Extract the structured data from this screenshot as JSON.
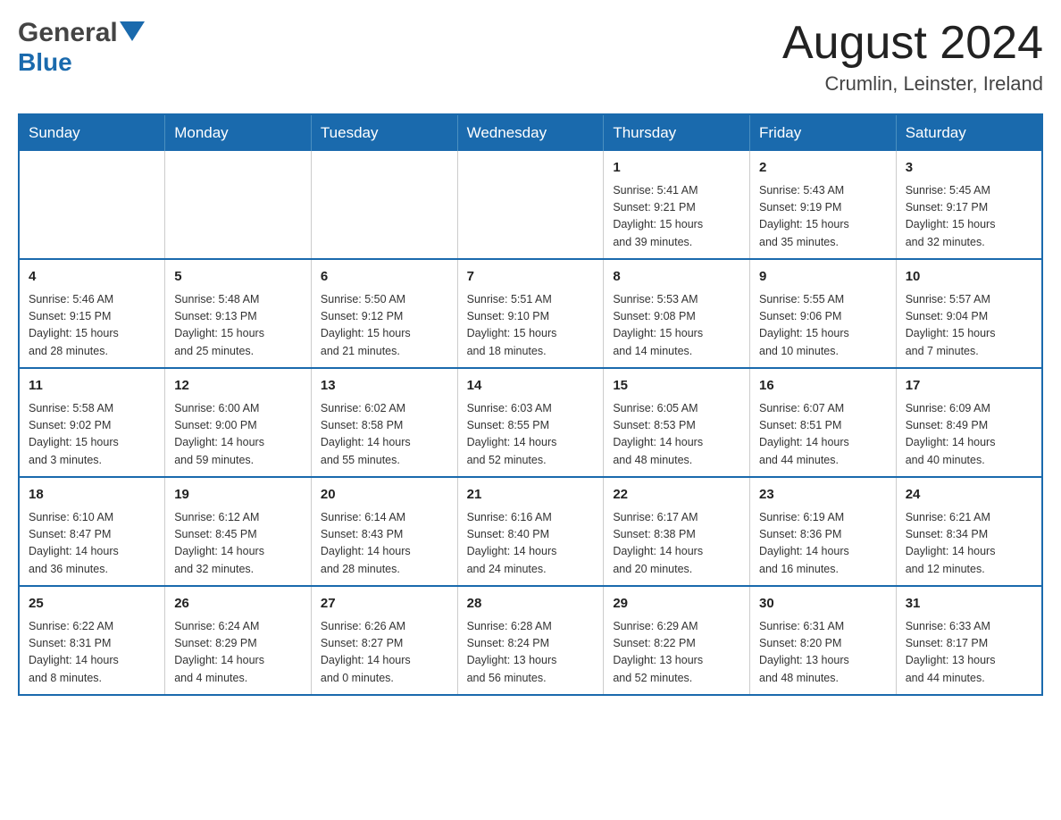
{
  "header": {
    "logo": {
      "general": "General",
      "blue": "Blue"
    },
    "title": "August 2024",
    "location": "Crumlin, Leinster, Ireland"
  },
  "days_of_week": [
    "Sunday",
    "Monday",
    "Tuesday",
    "Wednesday",
    "Thursday",
    "Friday",
    "Saturday"
  ],
  "weeks": [
    {
      "cells": [
        {
          "day": "",
          "info": ""
        },
        {
          "day": "",
          "info": ""
        },
        {
          "day": "",
          "info": ""
        },
        {
          "day": "",
          "info": ""
        },
        {
          "day": "1",
          "info": "Sunrise: 5:41 AM\nSunset: 9:21 PM\nDaylight: 15 hours\nand 39 minutes."
        },
        {
          "day": "2",
          "info": "Sunrise: 5:43 AM\nSunset: 9:19 PM\nDaylight: 15 hours\nand 35 minutes."
        },
        {
          "day": "3",
          "info": "Sunrise: 5:45 AM\nSunset: 9:17 PM\nDaylight: 15 hours\nand 32 minutes."
        }
      ]
    },
    {
      "cells": [
        {
          "day": "4",
          "info": "Sunrise: 5:46 AM\nSunset: 9:15 PM\nDaylight: 15 hours\nand 28 minutes."
        },
        {
          "day": "5",
          "info": "Sunrise: 5:48 AM\nSunset: 9:13 PM\nDaylight: 15 hours\nand 25 minutes."
        },
        {
          "day": "6",
          "info": "Sunrise: 5:50 AM\nSunset: 9:12 PM\nDaylight: 15 hours\nand 21 minutes."
        },
        {
          "day": "7",
          "info": "Sunrise: 5:51 AM\nSunset: 9:10 PM\nDaylight: 15 hours\nand 18 minutes."
        },
        {
          "day": "8",
          "info": "Sunrise: 5:53 AM\nSunset: 9:08 PM\nDaylight: 15 hours\nand 14 minutes."
        },
        {
          "day": "9",
          "info": "Sunrise: 5:55 AM\nSunset: 9:06 PM\nDaylight: 15 hours\nand 10 minutes."
        },
        {
          "day": "10",
          "info": "Sunrise: 5:57 AM\nSunset: 9:04 PM\nDaylight: 15 hours\nand 7 minutes."
        }
      ]
    },
    {
      "cells": [
        {
          "day": "11",
          "info": "Sunrise: 5:58 AM\nSunset: 9:02 PM\nDaylight: 15 hours\nand 3 minutes."
        },
        {
          "day": "12",
          "info": "Sunrise: 6:00 AM\nSunset: 9:00 PM\nDaylight: 14 hours\nand 59 minutes."
        },
        {
          "day": "13",
          "info": "Sunrise: 6:02 AM\nSunset: 8:58 PM\nDaylight: 14 hours\nand 55 minutes."
        },
        {
          "day": "14",
          "info": "Sunrise: 6:03 AM\nSunset: 8:55 PM\nDaylight: 14 hours\nand 52 minutes."
        },
        {
          "day": "15",
          "info": "Sunrise: 6:05 AM\nSunset: 8:53 PM\nDaylight: 14 hours\nand 48 minutes."
        },
        {
          "day": "16",
          "info": "Sunrise: 6:07 AM\nSunset: 8:51 PM\nDaylight: 14 hours\nand 44 minutes."
        },
        {
          "day": "17",
          "info": "Sunrise: 6:09 AM\nSunset: 8:49 PM\nDaylight: 14 hours\nand 40 minutes."
        }
      ]
    },
    {
      "cells": [
        {
          "day": "18",
          "info": "Sunrise: 6:10 AM\nSunset: 8:47 PM\nDaylight: 14 hours\nand 36 minutes."
        },
        {
          "day": "19",
          "info": "Sunrise: 6:12 AM\nSunset: 8:45 PM\nDaylight: 14 hours\nand 32 minutes."
        },
        {
          "day": "20",
          "info": "Sunrise: 6:14 AM\nSunset: 8:43 PM\nDaylight: 14 hours\nand 28 minutes."
        },
        {
          "day": "21",
          "info": "Sunrise: 6:16 AM\nSunset: 8:40 PM\nDaylight: 14 hours\nand 24 minutes."
        },
        {
          "day": "22",
          "info": "Sunrise: 6:17 AM\nSunset: 8:38 PM\nDaylight: 14 hours\nand 20 minutes."
        },
        {
          "day": "23",
          "info": "Sunrise: 6:19 AM\nSunset: 8:36 PM\nDaylight: 14 hours\nand 16 minutes."
        },
        {
          "day": "24",
          "info": "Sunrise: 6:21 AM\nSunset: 8:34 PM\nDaylight: 14 hours\nand 12 minutes."
        }
      ]
    },
    {
      "cells": [
        {
          "day": "25",
          "info": "Sunrise: 6:22 AM\nSunset: 8:31 PM\nDaylight: 14 hours\nand 8 minutes."
        },
        {
          "day": "26",
          "info": "Sunrise: 6:24 AM\nSunset: 8:29 PM\nDaylight: 14 hours\nand 4 minutes."
        },
        {
          "day": "27",
          "info": "Sunrise: 6:26 AM\nSunset: 8:27 PM\nDaylight: 14 hours\nand 0 minutes."
        },
        {
          "day": "28",
          "info": "Sunrise: 6:28 AM\nSunset: 8:24 PM\nDaylight: 13 hours\nand 56 minutes."
        },
        {
          "day": "29",
          "info": "Sunrise: 6:29 AM\nSunset: 8:22 PM\nDaylight: 13 hours\nand 52 minutes."
        },
        {
          "day": "30",
          "info": "Sunrise: 6:31 AM\nSunset: 8:20 PM\nDaylight: 13 hours\nand 48 minutes."
        },
        {
          "day": "31",
          "info": "Sunrise: 6:33 AM\nSunset: 8:17 PM\nDaylight: 13 hours\nand 44 minutes."
        }
      ]
    }
  ]
}
